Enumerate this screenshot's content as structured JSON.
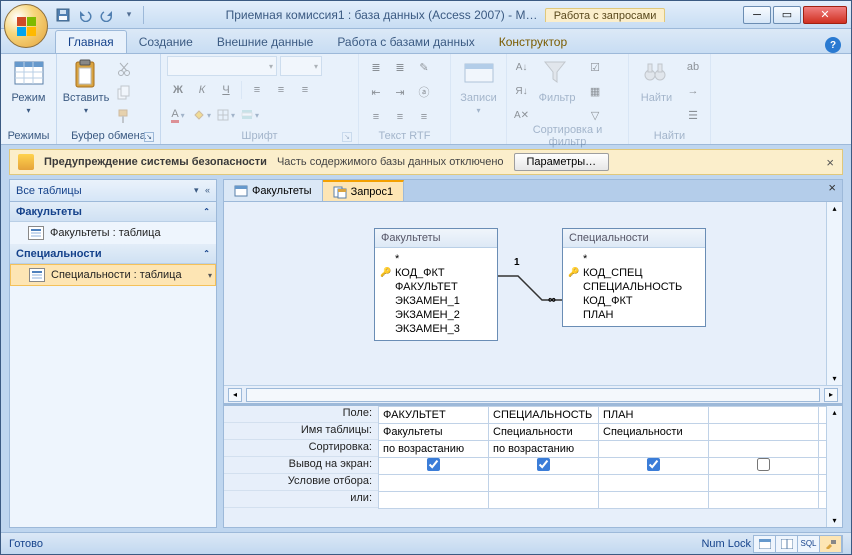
{
  "title": "Приемная комиссия1 : база данных (Access 2007) - M…",
  "context_title": "Работа с запросами",
  "tabs": {
    "main": "Главная",
    "create": "Создание",
    "external": "Внешние данные",
    "dbtools": "Работа с базами данных",
    "designer": "Конструктор"
  },
  "ribbon": {
    "modes": {
      "label": "Режимы",
      "mode_btn": "Режим"
    },
    "clipboard": {
      "label": "Буфер обмена",
      "paste_btn": "Вставить"
    },
    "font": {
      "label": "Шрифт"
    },
    "rtf": {
      "label": "Текст RTF"
    },
    "records": {
      "label": "Записи",
      "btn": "Записи"
    },
    "sortfilter": {
      "label": "Сортировка и фильтр",
      "filter": "Фильтр"
    },
    "find": {
      "label": "Найти",
      "btn": "Найти"
    }
  },
  "warning": {
    "title": "Предупреждение системы безопасности",
    "msg": "Часть содержимого базы данных отключено",
    "btn": "Параметры…"
  },
  "nav": {
    "header": "Все таблицы",
    "groups": [
      {
        "name": "Факультеты",
        "items": [
          "Факультеты : таблица"
        ]
      },
      {
        "name": "Специальности",
        "items": [
          "Специальности : таблица"
        ]
      }
    ]
  },
  "doc_tabs": [
    {
      "label": "Факультеты",
      "active": false
    },
    {
      "label": "Запрос1",
      "active": true
    }
  ],
  "tables": [
    {
      "name": "Факультеты",
      "star": "*",
      "fields": [
        {
          "name": "КОД_ФКТ",
          "key": true
        },
        {
          "name": "ФАКУЛЬТЕТ"
        },
        {
          "name": "ЭКЗАМЕН_1"
        },
        {
          "name": "ЭКЗАМЕН_2"
        },
        {
          "name": "ЭКЗАМЕН_3"
        }
      ]
    },
    {
      "name": "Специальности",
      "star": "*",
      "fields": [
        {
          "name": "КОД_СПЕЦ",
          "key": true
        },
        {
          "name": "СПЕЦИАЛЬНОСТЬ"
        },
        {
          "name": "КОД_ФКТ"
        },
        {
          "name": "ПЛАН"
        }
      ]
    }
  ],
  "relation": {
    "left_card": "1",
    "right_card": "∞"
  },
  "grid": {
    "labels": {
      "field": "Поле:",
      "table": "Имя таблицы:",
      "sort": "Сортировка:",
      "show": "Вывод на экран:",
      "criteria": "Условие отбора:",
      "or": "или:"
    },
    "columns": [
      {
        "field": "ФАКУЛЬТЕТ",
        "table": "Факультеты",
        "sort": "по возрастанию",
        "show": true
      },
      {
        "field": "СПЕЦИАЛЬНОСТЬ",
        "table": "Специальности",
        "sort": "по возрастанию",
        "show": true
      },
      {
        "field": "ПЛАН",
        "table": "Специальности",
        "sort": "",
        "show": true
      },
      {
        "field": "",
        "table": "",
        "sort": "",
        "show": false
      },
      {
        "field": "",
        "table": "",
        "sort": "",
        "show": false
      }
    ]
  },
  "status": {
    "ready": "Готово",
    "numlock": "Num Lock",
    "sql": "SQL"
  }
}
